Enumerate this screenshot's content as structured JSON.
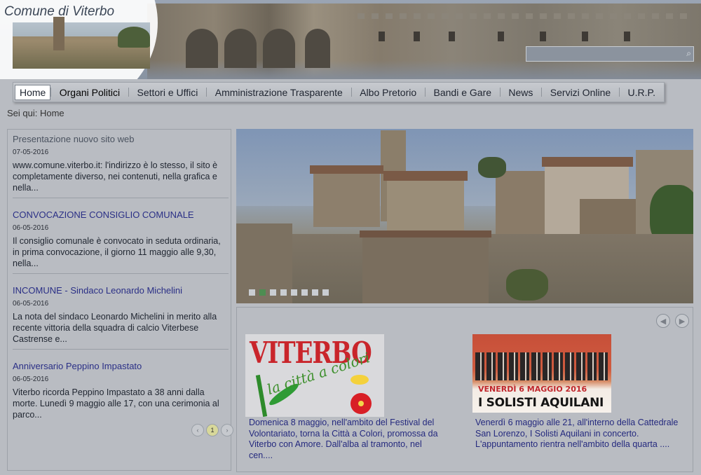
{
  "header": {
    "site_title": "Comune di Viterbo"
  },
  "nav": {
    "items": [
      {
        "label": "Home"
      },
      {
        "label": "Organi Politici"
      },
      {
        "label": "Settori e Uffici"
      },
      {
        "label": "Amministrazione Trasparente"
      },
      {
        "label": "Albo Pretorio"
      },
      {
        "label": "Bandi e Gare"
      },
      {
        "label": "News"
      },
      {
        "label": "Servizi Online"
      },
      {
        "label": "U.R.P."
      }
    ]
  },
  "breadcrumb": "Sei qui: Home",
  "news": [
    {
      "title": "Presentazione nuovo sito web",
      "date": "07-05-2016",
      "text": "www.comune.viterbo.it: l'indirizzo è lo stesso, il sito è completamente diverso, nei contenuti, nella grafica e nella..."
    },
    {
      "title": "CONVOCAZIONE CONSIGLIO COMUNALE",
      "date": "06-05-2016",
      "text": "Il consiglio comunale è convocato in seduta ordinaria, in prima convocazione, il giorno 11 maggio alle 9,30, nella..."
    },
    {
      "title": "INCOMUNE - Sindaco Leonardo Michelini",
      "date": "06-05-2016",
      "text": "La nota del sindaco Leonardo Michelini in merito alla recente vittoria della squadra di calcio Viterbese Castrense e..."
    },
    {
      "title": "Anniversario Peppino Impastato",
      "date": "06-05-2016",
      "text": "Viterbo ricorda Peppino Impastato a 38 anni dalla morte. Lunedì 9 maggio alle 17, con una cerimonia al parco..."
    }
  ],
  "pager": {
    "prev": "‹",
    "page": "1",
    "next": "›"
  },
  "slideshow": {
    "slide_count": 8,
    "active_index": 1
  },
  "featured": {
    "prev": "◀",
    "next": "▶",
    "items": [
      {
        "image_logo": "VITERBO",
        "image_script": "la città a colori",
        "text": "Domenica 8 maggio, nell'ambito del Festival del Volontariato, torna la Città a Colori, promossa da Viterbo con Amore. Dall'alba al tramonto, nel cen...."
      },
      {
        "image_date": "VENERDÌ 6 MAGGIO 2016",
        "image_title": "I SOLISTI AQUILANI",
        "text": "Venerdì 6 maggio alle 21, all'interno della Cattedrale San Lorenzo, I Solisti Aquilani in concerto. L'appuntamento rientra nell'ambito della quarta ...."
      }
    ]
  },
  "colors": {
    "link": "#2a2f86",
    "active_dot": "#4d8d52",
    "overlay": "#b9bcc2"
  }
}
